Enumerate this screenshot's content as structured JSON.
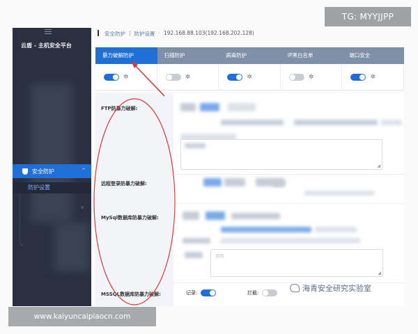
{
  "sidebar": {
    "platform_title": "云盾 - 主机安全平台",
    "nav_security": "安全防护",
    "nav_protect_settings": "防护设置"
  },
  "breadcrumb": {
    "root": "安全防护",
    "current": "防护设置",
    "ip": "192.168.88.103(192.168.202.128)"
  },
  "tabs": [
    {
      "label": "暴力破解防护",
      "active": true
    },
    {
      "label": "扫描防护",
      "active": false
    },
    {
      "label": "病毒防护",
      "active": false
    },
    {
      "label": "IP黑白名单",
      "active": false
    },
    {
      "label": "端口安全",
      "active": false
    }
  ],
  "toggles": [
    {
      "state": "on"
    },
    {
      "state": "off"
    },
    {
      "state": "on"
    },
    {
      "state": "off"
    },
    {
      "state": "on"
    }
  ],
  "sections": {
    "ftp": "FTP防暴力破解:",
    "remote": "远程登录防暴力破解:",
    "mysql": "MySql数据库防暴力破解:",
    "mssql": "MSSQL数据库防暴力破解:"
  },
  "textarea_placeholder": "说明",
  "bottom_options": {
    "record": "记录:",
    "block": "拦截:"
  },
  "watermarks": {
    "top": "TG: MYYJJPP",
    "bottom": "www.kaiyuncaipiaocn.com",
    "lab": "海青安全研究实验室"
  },
  "colors": {
    "accent": "#1f6fd6",
    "sidebar_bg": "#2a3040",
    "annotation_red": "#d83a3a"
  }
}
